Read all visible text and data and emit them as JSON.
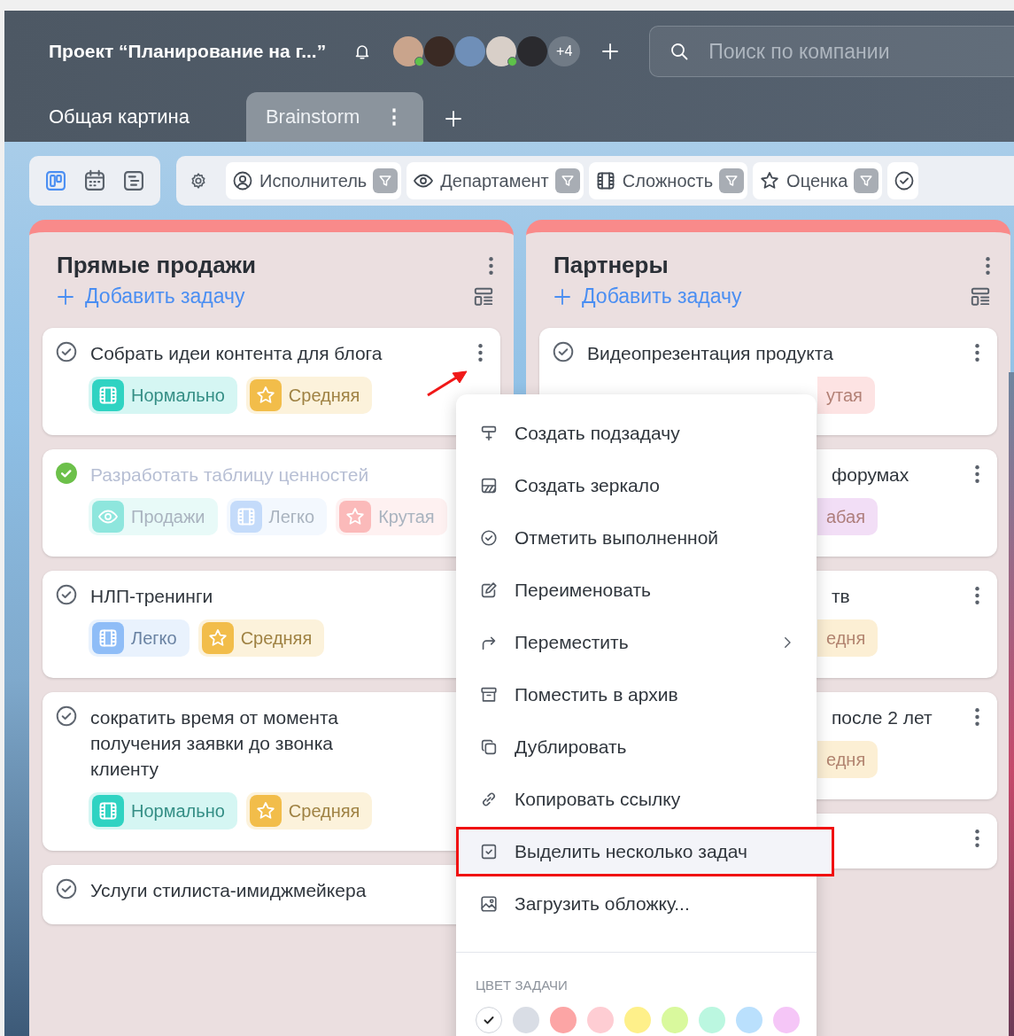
{
  "header": {
    "project_title": "Проект “Планирование на г...”",
    "avatars": [
      {
        "online": true
      },
      {
        "online": false
      },
      {
        "online": false
      },
      {
        "online": true
      },
      {
        "online": false
      }
    ],
    "avatars_more": "+4",
    "search": {
      "placeholder": "Поиск по компании"
    }
  },
  "tabs": [
    {
      "label": "Общая картина",
      "selected": false
    },
    {
      "label": "Brainstorm",
      "selected": true,
      "menu": "⋮"
    }
  ],
  "views": [
    {
      "kind": "board",
      "selected": true
    },
    {
      "kind": "calendar",
      "selected": false
    },
    {
      "kind": "list",
      "selected": false
    }
  ],
  "filters": [
    {
      "kind": "person",
      "label": "Исполнитель"
    },
    {
      "kind": "eye",
      "label": "Департамент"
    },
    {
      "kind": "film",
      "label": "Сложность"
    },
    {
      "kind": "star",
      "label": "Оценка"
    },
    {
      "kind": "check"
    }
  ],
  "columns": [
    {
      "title": "Прямые продажи",
      "add_label": "Добавить задачу",
      "cards": [
        {
          "title": "Собрать идеи контента для блога",
          "done": false,
          "clipped": false,
          "tags": [
            {
              "kind": "film",
              "label": "Нормально",
              "color": "#2fd3c2"
            },
            {
              "kind": "star",
              "label": "Средняя",
              "color": "#f2bd4a"
            }
          ]
        },
        {
          "title": "Разработать таблицу ценностей",
          "done": true,
          "clipped": false,
          "tags": [
            {
              "kind": "eye",
              "label": "Продажи",
              "color": "#8ee6dd"
            },
            {
              "kind": "film",
              "label": "Легко",
              "color": "#c4dbfa"
            },
            {
              "kind": "star",
              "label": "Крутая",
              "color": "#fbbaba"
            }
          ]
        },
        {
          "title": "НЛП-тренинги",
          "done": false,
          "clipped": false,
          "tags": [
            {
              "kind": "film",
              "label": "Легко",
              "color": "#8fbdf7"
            },
            {
              "kind": "star",
              "label": "Средняя",
              "color": "#f2bd4a"
            }
          ]
        },
        {
          "title": "сократить время от момента получения заявки до звонка клиенту",
          "done": false,
          "clipped": false,
          "tags": [
            {
              "kind": "film",
              "label": "Нормально",
              "color": "#2fd3c2"
            },
            {
              "kind": "star",
              "label": "Средняя",
              "color": "#f2bd4a"
            }
          ]
        },
        {
          "title": "Услуги стилиста-имиджмейкера",
          "done": false,
          "clipped": false
        }
      ]
    },
    {
      "title": "Партнеры",
      "add_label": "Добавить задачу",
      "cards": [
        {
          "title": "Видеопрезентация продукта",
          "done": false,
          "clipped": false,
          "tags": [
            {
              "kind": "fragment",
              "label": "утая",
              "color": "#fde3e3"
            }
          ]
        },
        {
          "title": "форумах",
          "done": false,
          "clipped": true,
          "tags": [
            {
              "kind": "fragment",
              "label": "абая",
              "color": "#f2def6"
            }
          ]
        },
        {
          "title": "тв",
          "done": false,
          "clipped": true,
          "tags": [
            {
              "kind": "fragment",
              "label": "едня",
              "color": "#fcefd4"
            }
          ]
        },
        {
          "title": "после 2 лет",
          "done": false,
          "clipped": true,
          "tags": [
            {
              "kind": "fragment",
              "label": "едня",
              "color": "#fcefd4"
            }
          ]
        },
        {
          "done": false,
          "clipped": true
        }
      ]
    }
  ],
  "context_menu": {
    "items": [
      {
        "kind": "subtask",
        "label": "Создать подзадачу",
        "highlighted": false,
        "submenu": false
      },
      {
        "kind": "mirror",
        "label": "Создать зеркало",
        "highlighted": false,
        "submenu": false
      },
      {
        "kind": "complete",
        "label": "Отметить выполненной",
        "highlighted": false,
        "submenu": false
      },
      {
        "kind": "rename",
        "label": "Переименовать",
        "highlighted": false,
        "submenu": false
      },
      {
        "kind": "move",
        "label": "Переместить",
        "highlighted": false,
        "submenu": true
      },
      {
        "kind": "archive",
        "label": "Поместить в архив",
        "highlighted": false,
        "submenu": false
      },
      {
        "kind": "duplicate",
        "label": "Дублировать",
        "highlighted": false,
        "submenu": false
      },
      {
        "kind": "link",
        "label": "Копировать ссылку",
        "highlighted": false,
        "submenu": false
      },
      {
        "kind": "select",
        "label": "Выделить несколько задач",
        "highlighted": true,
        "submenu": false
      },
      {
        "kind": "cover",
        "label": "Загрузить обложку...",
        "highlighted": false,
        "submenu": false
      }
    ],
    "color_heading": "ЦВЕТ ЗАДАЧИ",
    "colors": [
      {
        "color": "#ffffff",
        "selected": true
      },
      {
        "color": "#d9dde5",
        "selected": false
      },
      {
        "color": "#fca5a5",
        "selected": false
      },
      {
        "color": "#fecdd3",
        "selected": false
      },
      {
        "color": "#fef08a",
        "selected": false
      },
      {
        "color": "#d9f99d",
        "selected": false
      },
      {
        "color": "#bbf7e0",
        "selected": false
      },
      {
        "color": "#bae0fd",
        "selected": false
      },
      {
        "color": "#f5c6f7",
        "selected": false
      }
    ]
  }
}
